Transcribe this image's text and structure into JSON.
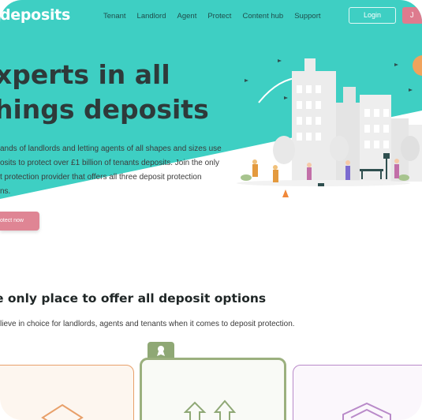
{
  "nav": {
    "logo": "deposits",
    "links": [
      "Tenant",
      "Landlord",
      "Agent",
      "Protect",
      "Content hub",
      "Support"
    ],
    "login_label": "Login",
    "join_label": "J"
  },
  "hero": {
    "title_line1": "xperts in all",
    "title_line2": "hings deposits",
    "text_lines": [
      "ands of landlords and letting agents of all shapes and sizes use",
      "osits to protect over £1 billion of tenants deposits. Join the only",
      "t protection provider that offers all three deposit protection",
      "ns."
    ],
    "cta_label": "otect now"
  },
  "section": {
    "title": "e only place to offer all deposit options",
    "subtitle": "lieve in choice for landlords, agents and tenants when it comes to deposit protection."
  },
  "colors": {
    "teal": "#3ecfc3",
    "pink": "#de7b8e",
    "green": "#9bb07e",
    "orange": "#e8a06a",
    "purple": "#b98ac9"
  },
  "icons": {
    "badge": "award-icon",
    "mid_card": "upload-arrows-icon",
    "left_card": "box-icon",
    "right_card": "box-icon"
  }
}
